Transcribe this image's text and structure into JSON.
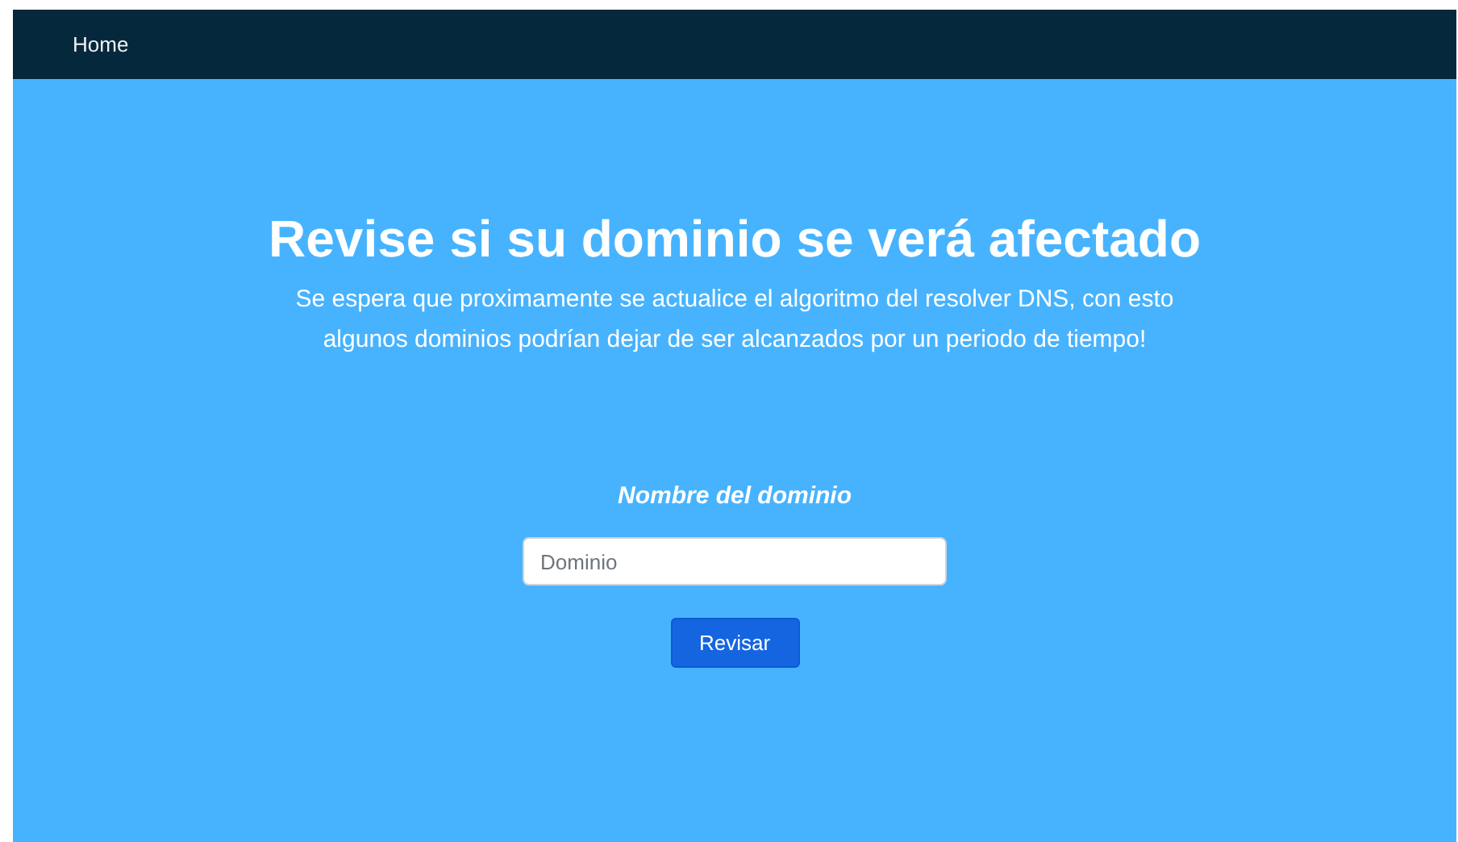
{
  "navbar": {
    "links": [
      {
        "label": "Home"
      }
    ]
  },
  "hero": {
    "title": "Revise si su dominio se verá afectado",
    "subtitle": "Se espera que proximamente se actualice el algoritmo del resolver DNS, con esto algunos dominios podrían dejar de ser alcanzados por un periodo de tiempo!"
  },
  "form": {
    "label": "Nombre del dominio",
    "field": {
      "placeholder": "Dominio"
    },
    "button": "Revisar"
  }
}
